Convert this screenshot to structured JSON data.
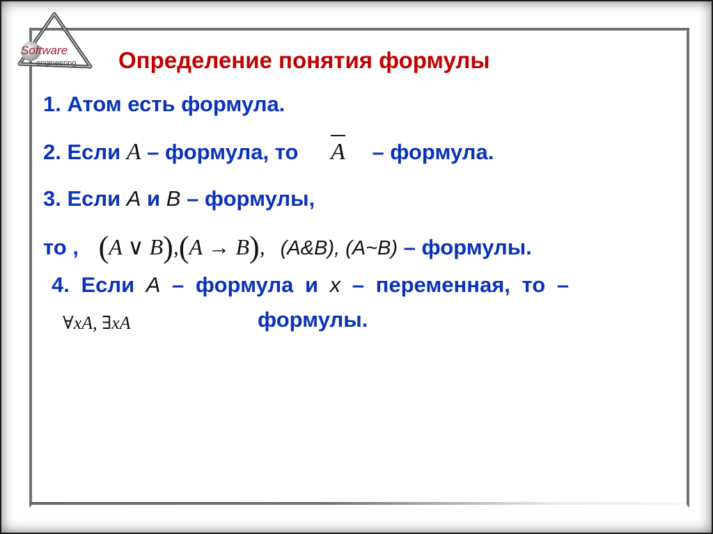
{
  "logo": {
    "line1": "Software",
    "line2": "engineering"
  },
  "title": "Определение понятия формулы",
  "items": {
    "item1": "1. Атом есть формула.",
    "item2": {
      "prefix": "2. Если ",
      "var": "A",
      "middle": " – формула, то ",
      "negated": "A",
      "suffix": " – формула."
    },
    "item3": {
      "line1_prefix": "3. Если ",
      "var_a": "A",
      "and": " и ",
      "var_b": "B",
      "line1_suffix": " – формулы,",
      "line2_prefix": "то , ",
      "disj": "A ∨ B",
      "impl": "A → B",
      "conj": "(A&B), (A~B)",
      "line2_suffix": " – формулы."
    },
    "item4": {
      "prefix": "4. Если ",
      "var_a": "A",
      "middle1": " – формула и ",
      "var_x": "x",
      "middle2": " – переменная, то  –",
      "quantifiers": "∀xA, ∃xA",
      "suffix": "формулы."
    }
  }
}
